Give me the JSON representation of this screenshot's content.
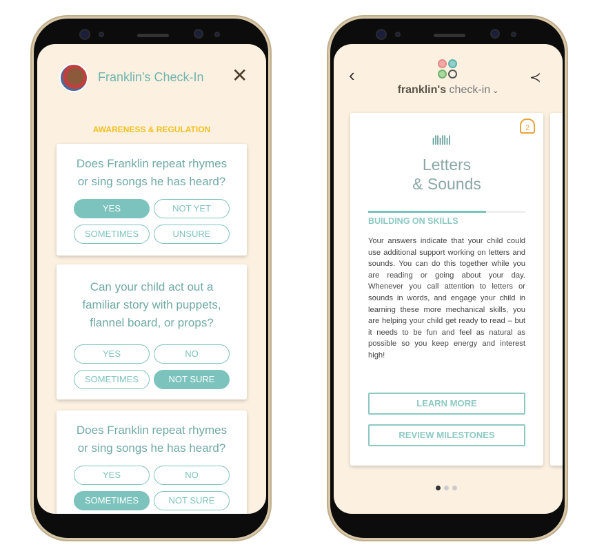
{
  "left": {
    "title": "Franklin's Check-In",
    "section": "AWARENESS & REGULATION",
    "steps": [
      "done",
      "done",
      "current",
      "todo"
    ],
    "questions": [
      {
        "text": "Does Franklin repeat rhymes or sing songs he has heard?",
        "options": [
          "YES",
          "NOT YET",
          "SOMETIMES",
          "UNSURE"
        ],
        "selected": 0
      },
      {
        "text": "Can your child act out a familiar story with puppets, flannel board, or props?",
        "options": [
          "YES",
          "NO",
          "SOMETIMES",
          "NOT SURE"
        ],
        "selected": 3
      },
      {
        "text": "Does Franklin repeat rhymes or sing songs he has heard?",
        "options": [
          "YES",
          "NO",
          "SOMETIMES",
          "NOT SURE"
        ],
        "selected": 2
      }
    ]
  },
  "right": {
    "title_bold": "franklin's",
    "title_rest": " check-in",
    "bell_count": "2",
    "card_title_1": "Letters",
    "card_title_2": "& Sounds",
    "progress": 0.75,
    "subheading": "BUILDING ON SKILLS",
    "body": "Your answers indicate that your child could use additional support working on letters and sounds. You can do this together while you are reading or going about your day. Whenever you call attention to letters or sounds in words, and engage your child in learning these more mechanical skills, you are helping your child get ready to read – but it needs to be fun and feel as natural as possible so you keep energy and interest high!",
    "learn_more": "LEARN MORE",
    "review": "REVIEW MILESTONES",
    "page": 1,
    "pages": 3
  },
  "colors": {
    "teal": "#7cc3bd",
    "yellow": "#f2bf1e",
    "bg": "#fcf1e1"
  }
}
